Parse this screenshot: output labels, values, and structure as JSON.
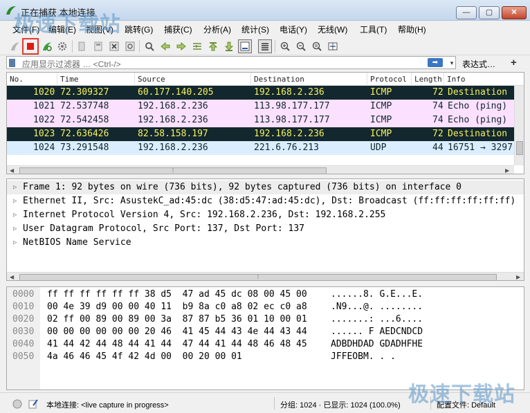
{
  "window": {
    "title": "正在捕获 本地连接",
    "min_label": "—",
    "max_label": "▢",
    "close_label": "✕"
  },
  "watermark": "极速下载站",
  "menu": [
    "文件(F)",
    "编辑(E)",
    "视图(V)",
    "跳转(G)",
    "捕获(C)",
    "分析(A)",
    "统计(S)",
    "电话(Y)",
    "无线(W)",
    "工具(T)",
    "帮助(H)"
  ],
  "filter": {
    "placeholder": "应用显示过滤器 … <Ctrl-/>",
    "apply_label": "➡",
    "dropdown_label": "▾",
    "expression_label": "表达式…",
    "plus_label": "+"
  },
  "packet_list": {
    "columns": [
      "No.",
      "Time",
      "Source",
      "Destination",
      "Protocol",
      "Length",
      "Info"
    ],
    "rows": [
      {
        "no": "1020",
        "time": "72.309327",
        "source": "60.177.140.205",
        "destination": "192.168.2.236",
        "protocol": "ICMP",
        "length": "72",
        "info": "Destination",
        "style": "dark"
      },
      {
        "no": "1021",
        "time": "72.537748",
        "source": "192.168.2.236",
        "destination": "113.98.177.177",
        "protocol": "ICMP",
        "length": "74",
        "info": "Echo (ping)",
        "style": "pink"
      },
      {
        "no": "1022",
        "time": "72.542458",
        "source": "192.168.2.236",
        "destination": "113.98.177.177",
        "protocol": "ICMP",
        "length": "74",
        "info": "Echo (ping)",
        "style": "pink"
      },
      {
        "no": "1023",
        "time": "72.636426",
        "source": "82.58.158.197",
        "destination": "192.168.2.236",
        "protocol": "ICMP",
        "length": "72",
        "info": "Destination",
        "style": "dark"
      },
      {
        "no": "1024",
        "time": "73.291548",
        "source": "192.168.2.236",
        "destination": "221.6.76.213",
        "protocol": "UDP",
        "length": "44",
        "info": "16751 → 3297",
        "style": "blue"
      }
    ]
  },
  "details": [
    "Frame 1: 92 bytes on wire (736 bits), 92 bytes captured (736 bits) on interface 0",
    "Ethernet II, Src: AsustekC_ad:45:dc (38:d5:47:ad:45:dc), Dst: Broadcast (ff:ff:ff:ff:ff:ff)",
    "Internet Protocol Version 4, Src: 192.168.2.236, Dst: 192.168.2.255",
    "User Datagram Protocol, Src Port: 137, Dst Port: 137",
    "NetBIOS Name Service"
  ],
  "bytes": [
    {
      "offset": "0000",
      "hex": "ff ff ff ff ff ff 38 d5  47 ad 45 dc 08 00 45 00",
      "ascii": "......8. G.E...E."
    },
    {
      "offset": "0010",
      "hex": "00 4e 39 d9 00 00 40 11  b9 8a c0 a8 02 ec c0 a8",
      "ascii": ".N9...@. ........"
    },
    {
      "offset": "0020",
      "hex": "02 ff 00 89 00 89 00 3a  87 87 b5 36 01 10 00 01",
      "ascii": ".......: ...6...."
    },
    {
      "offset": "0030",
      "hex": "00 00 00 00 00 00 20 46  41 45 44 43 4e 44 43 44",
      "ascii": "...... F AEDCNDCD"
    },
    {
      "offset": "0040",
      "hex": "41 44 42 44 48 44 41 44  47 44 41 44 48 46 48 45",
      "ascii": "ADBDHDAD GDADHFHE"
    },
    {
      "offset": "0050",
      "hex": "4a 46 46 45 4f 42 4d 00  00 20 00 01",
      "ascii": "JFFEOBM. . ."
    }
  ],
  "status": {
    "interface": "本地连接: <live capture in progress>",
    "packets": "分组: 1024 · 已显示: 1024 (100.0%)",
    "profile": "配置文件: Default"
  },
  "colors": {
    "row_dark_bg": "#12272e",
    "row_dark_fg": "#f7f25a",
    "row_pink_bg": "#fce0ff",
    "row_blue_bg": "#daeeff",
    "stop_red": "#e2190f"
  }
}
